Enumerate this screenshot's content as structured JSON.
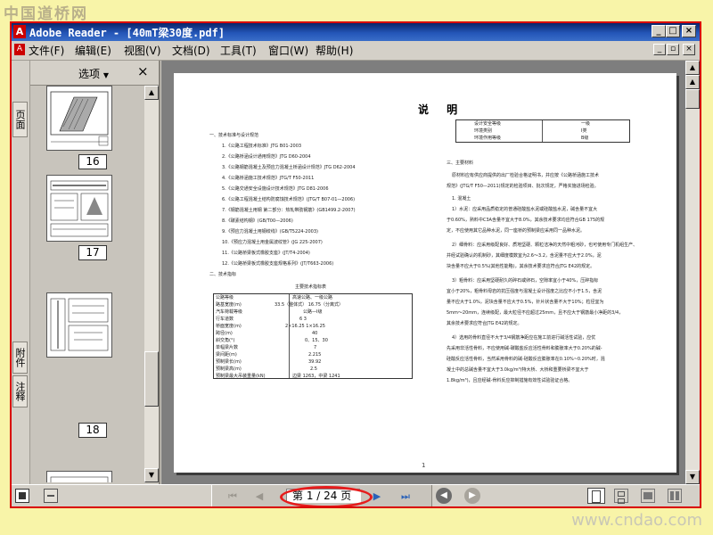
{
  "watermark": {
    "site_name": "中国道桥网",
    "site_url": "www.cndao.com"
  },
  "window": {
    "title": "Adobe Reader - [40mT梁30度.pdf]",
    "app_icon": "adobe-reader-icon"
  },
  "menu": {
    "items": [
      "文件(F)",
      "编辑(E)",
      "视图(V)",
      "文档(D)",
      "工具(T)",
      "窗口(W)",
      "帮助(H)"
    ]
  },
  "nav_tabs": {
    "pages": "页面",
    "attachments": "附件",
    "comments": "注释"
  },
  "thumbnails": {
    "options_label": "选项",
    "close_symbol": "×",
    "pages": [
      {
        "label": "16"
      },
      {
        "label": "17"
      },
      {
        "label": "18"
      }
    ]
  },
  "document": {
    "page_title": "说 明",
    "left_column": {
      "heading1": "一、技术标准与设计规范",
      "standards": [
        "1.《公路工程技术标准》JTG B01-2003",
        "2.《公路桥涵设计通用规范》JTG D60-2004",
        "3.《公路钢筋混凝土及预应力混凝土桥涵设计规范》JTG D62-2004",
        "4.《公路桥涵施工技术规范》JTG/T F50-2011",
        "5.《公路交通安全设施设计技术规范》JTG D81-2006",
        "6.《公路工程混凝土结构防腐蚀技术规范》(JTG/T B07-01—2006)",
        "7.《钢筋混凝土用钢 第二部分：热轧带肋钢筋》(GB1499.2-2007)",
        "8.《碳素结构钢》(GB/T00—2006)",
        "9.《预应力混凝土用钢绞线》(GB/T5224-2003)",
        "10.《预应力混凝土用金属波纹管》(JG 225-2007)",
        "11.《公路桥梁板式橡胶支座》(JT/T4-2004)",
        "12.《公路桥梁板式橡胶支座规格系列》(JT/T663-2006)"
      ],
      "heading2": "二、技术指标",
      "table_caption": "主要技术指标表",
      "table_rows": [
        [
          "公路等级",
          "高速公路、一级公路"
        ],
        [
          "路基宽度(m)",
          "33.5（整体式）    16.75（分离式）"
        ],
        [
          "汽车荷载等级",
          "公路—Ⅰ级"
        ],
        [
          "行车道数",
          "6    3"
        ],
        [
          "桥面宽度(m)",
          "2×16.25    1×16.25"
        ],
        [
          "跨径(m)",
          "40"
        ],
        [
          "斜交角(°)",
          "0、15、30"
        ],
        [
          "单幅梁片数",
          "7"
        ],
        [
          "梁间距(m)",
          "2.215"
        ],
        [
          "预制梁长(m)",
          "39.92"
        ],
        [
          "预制梁高(m)",
          "2.5"
        ],
        [
          "预制梁最大吊装重量(kN)",
          "边梁 1263，中梁 1241"
        ]
      ]
    },
    "right_column": {
      "env_rows": [
        [
          "设计安全等级",
          "一级"
        ],
        [
          "环境类别",
          "Ⅰ类"
        ],
        [
          "环境作用等级",
          "B级"
        ]
      ],
      "heading3": "三、主要材料",
      "paragraphs": [
        "原材料应有供应商提供的出厂检验合格证明书，并应按《公路桥涵施工技术",
        "规范》(JTG/T F50—2011)规定的检验项目、批次规定，严格实施进场检验。",
        "1. 混凝土",
        "1）水泥：应采用品质稳定的普通硅酸盐水泥或硅酸盐水泥，碱含量不宜大",
        "于0.60%，熟料中C3A含量不宜大于8.0%，其余技术要求均应符合GB 175的规",
        "定，不应使用其它品种水泥，同一座桥的预制梁应采用同一品种水泥。",
        "2）细骨料：应采用级配良好、质地坚硬、颗粒洁净的天然中粗河砂，也可使用专门机组生产、",
        "并经试验确认的机制砂，其细度模数宜为2.6～3.2，含泥量不应大于2.0%，泥",
        "块含量不应大于0.5%(其他性能略)，其余技术要求应符合JTG E42的规定。",
        "3）粗骨料：应采用坚硬耐久的碎石或卵石，空隙率宜小于40%，压碎指标",
        "宜小于20%，粗骨料母岩的抗压强度与混凝土设计强度之比应不小于1.5，含泥",
        "量不应大于1.0%，泥块含量不应大于0.5%，针片状含量不大于10%；粒径宜为",
        "5mm～20mm，连续级配，最大粒径不应超过25mm，且不应大于钢筋最小净距的3/4，",
        "其余技术要求应符合JTG E42的规定。",
        "4）选用的骨料直径不大于3/4钢筋净距应在施工前进行碱活性试验，应优",
        "先采用非活性骨料，不应使用碱-碳酸盐反应活性骨料和膨胀率大于0.20%的碱-",
        "硅酸反应活性骨料，当然采用骨料的碱-硅酸反应膨胀率在0.10%~0.20%时，混",
        "凝土中的总碱含量不宜大于3.0kg/m³(特大桥、大桥和重要桥梁不宜大于",
        "1.8kg/m³)，且应经碱-骨料反应抑制措施有效性试验验证合格。"
      ]
    },
    "page_number": "1"
  },
  "navigation": {
    "current_page": "1",
    "total_pages": "24",
    "page_display": "第 1 ∕ 24 页"
  },
  "colors": {
    "title_bar": "#0a246a",
    "chrome": "#d4d0c8",
    "highlight": "#e61c1c",
    "frame": "#d90000"
  }
}
